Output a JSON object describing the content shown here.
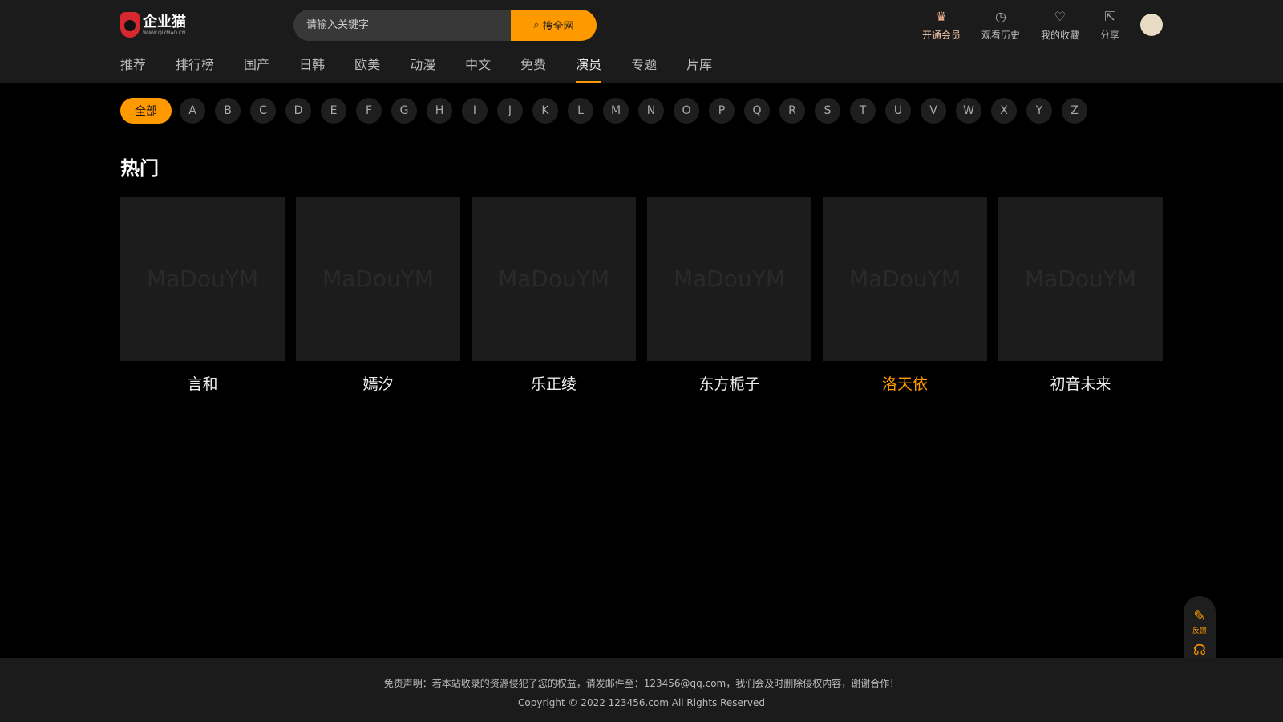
{
  "header": {
    "logo_name": "企业猫",
    "logo_url": "WWW.QIYMAO.CN",
    "search_placeholder": "请输入关键字",
    "search_button": "搜全网",
    "actions": [
      {
        "icon": "crown-icon",
        "label": "开通会员"
      },
      {
        "icon": "clock-icon",
        "label": "观看历史"
      },
      {
        "icon": "heart-icon",
        "label": "我的收藏"
      },
      {
        "icon": "share-icon",
        "label": "分享"
      }
    ]
  },
  "nav": [
    "推荐",
    "排行榜",
    "国产",
    "日韩",
    "欧美",
    "动漫",
    "中文",
    "免费",
    "演员",
    "专题",
    "片库"
  ],
  "nav_active": "演员",
  "letters": {
    "all": "全部",
    "items": [
      "A",
      "B",
      "C",
      "D",
      "E",
      "F",
      "G",
      "H",
      "I",
      "J",
      "K",
      "L",
      "M",
      "N",
      "O",
      "P",
      "Q",
      "R",
      "S",
      "T",
      "U",
      "V",
      "W",
      "X",
      "Y",
      "Z"
    ]
  },
  "section_title": "热门",
  "placeholder_text": "MaDouYM",
  "actors": [
    "言和",
    "嫣汐",
    "乐正绫",
    "东方栀子",
    "洛天依",
    "初音未来"
  ],
  "float": {
    "feedback": "反馈",
    "service": "客服"
  },
  "footer": {
    "disclaimer": "免责声明：若本站收录的资源侵犯了您的权益，请发邮件至：123456@qq.com，我们会及时删除侵权内容，谢谢合作！",
    "copyright": "Copyright © 2022 123456.com All Rights Reserved"
  }
}
